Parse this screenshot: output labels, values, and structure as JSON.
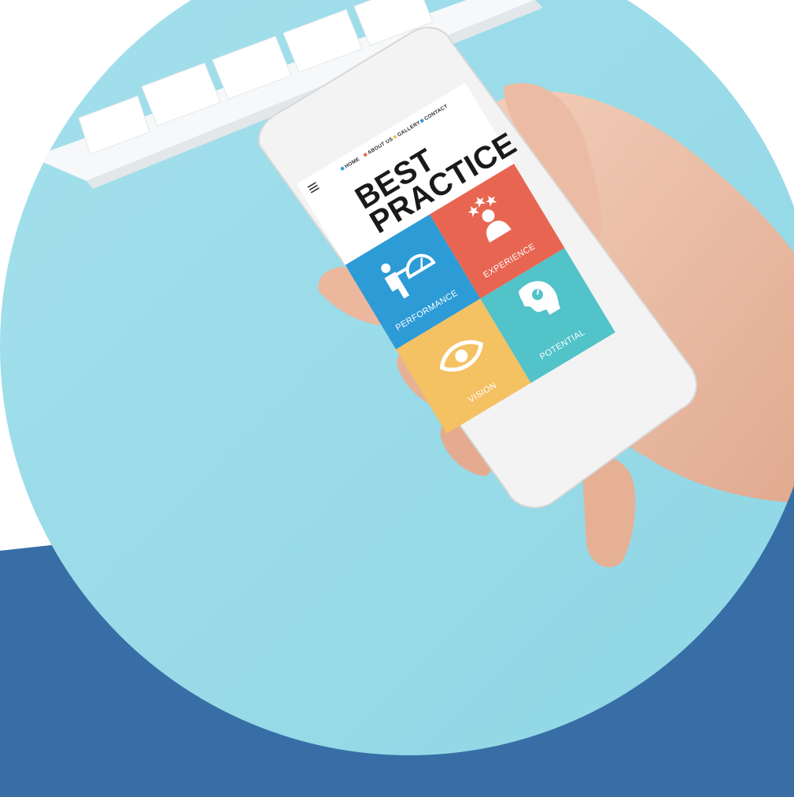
{
  "colors": {
    "background_blue": "#376ea6",
    "circle_light_blue": "#98dbe8",
    "keyboard_white": "#f6f8f9",
    "phone_frame": "#f3f3f3",
    "tile_performance": "#2d9bd6",
    "tile_experience": "#e86651",
    "tile_vision": "#f4c163",
    "tile_potential": "#51c3c9",
    "nav_dot_home": "#2d9bd6",
    "nav_dot_about": "#e86651",
    "nav_dot_gallery": "#f4c163",
    "nav_dot_contact": "#2d9bd6"
  },
  "phone": {
    "nav": {
      "menu_icon": "hamburger-menu-icon",
      "items": [
        {
          "label": "HOME"
        },
        {
          "label": "ABOUT US"
        },
        {
          "label": "GALLERY"
        },
        {
          "label": "CONTACT"
        }
      ]
    },
    "title_line1": "BEST",
    "title_line2": "PRACTICE",
    "tiles": [
      {
        "label": "PERFORMANCE",
        "icon": "person-speedometer-icon"
      },
      {
        "label": "EXPERIENCE",
        "icon": "person-stars-icon"
      },
      {
        "label": "VISION",
        "icon": "eye-icon"
      },
      {
        "label": "POTENTIAL",
        "icon": "head-speedometer-icon"
      }
    ]
  }
}
